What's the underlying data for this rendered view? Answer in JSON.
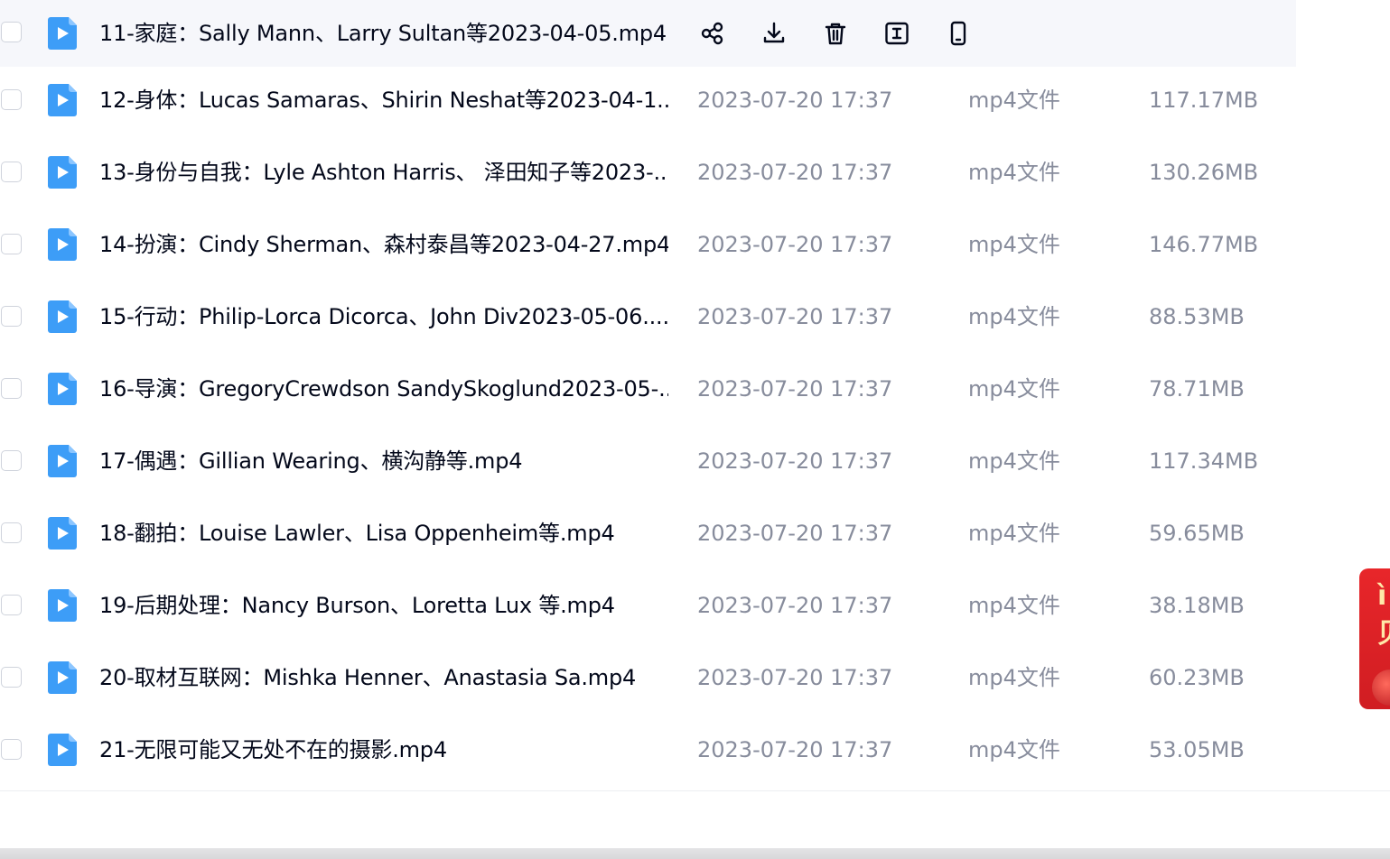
{
  "files": [
    {
      "name": "11-家庭：Sally Mann、Larry Sultan等2023-04-05.mp4",
      "date": "",
      "type": "",
      "size": ""
    },
    {
      "name": "12-身体：Lucas Samaras、Shirin Neshat等2023-04-1...",
      "date": "2023-07-20 17:37",
      "type": "mp4文件",
      "size": "117.17MB"
    },
    {
      "name": "13-身份与自我：Lyle Ashton Harris、 泽田知子等2023-...",
      "date": "2023-07-20 17:37",
      "type": "mp4文件",
      "size": "130.26MB"
    },
    {
      "name": "14-扮演：Cindy Sherman、森村泰昌等2023-04-27.mp4",
      "date": "2023-07-20 17:37",
      "type": "mp4文件",
      "size": "146.77MB"
    },
    {
      "name": "15-行动：Philip-Lorca Dicorca、John Div2023-05-06....",
      "date": "2023-07-20 17:37",
      "type": "mp4文件",
      "size": "88.53MB"
    },
    {
      "name": "16-导演：GregoryCrewdson SandySkoglund2023-05-...",
      "date": "2023-07-20 17:37",
      "type": "mp4文件",
      "size": "78.71MB"
    },
    {
      "name": "17-偶遇：Gillian Wearing、横沟静等.mp4",
      "date": "2023-07-20 17:37",
      "type": "mp4文件",
      "size": "117.34MB"
    },
    {
      "name": "18-翻拍：Louise Lawler、Lisa Oppenheim等.mp4",
      "date": "2023-07-20 17:37",
      "type": "mp4文件",
      "size": "59.65MB"
    },
    {
      "name": "19-后期处理：Nancy Burson、Loretta Lux 等.mp4",
      "date": "2023-07-20 17:37",
      "type": "mp4文件",
      "size": "38.18MB"
    },
    {
      "name": "20-取材互联网：Mishka Henner、Anastasia Sa.mp4",
      "date": "2023-07-20 17:37",
      "type": "mp4文件",
      "size": "60.23MB"
    },
    {
      "name": "21-无限可能又无处不在的摄影.mp4",
      "date": "2023-07-20 17:37",
      "type": "mp4文件",
      "size": "53.05MB"
    }
  ],
  "hover_actions": [
    "share-icon",
    "download-icon",
    "delete-icon",
    "rename-icon",
    "phone-icon"
  ],
  "promo": {
    "line1": "ì",
    "line2": "贝"
  },
  "colors": {
    "video_icon": "#3d9df7",
    "hover_row": "#f6f7fb",
    "meta_text": "#878c9c",
    "promo": "#e8262a"
  }
}
